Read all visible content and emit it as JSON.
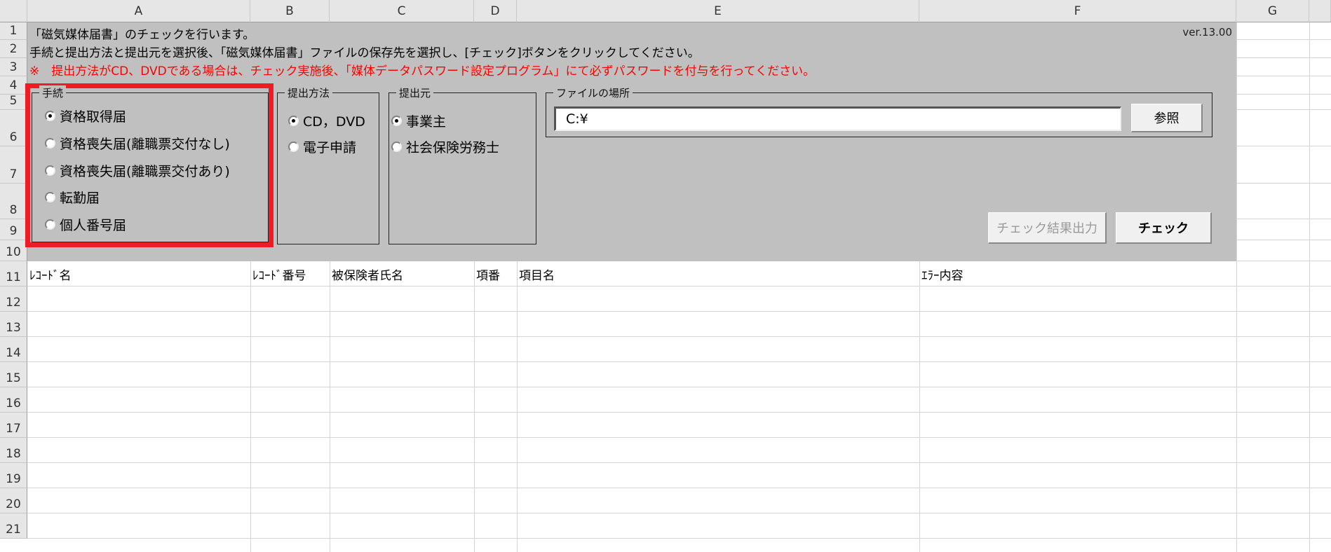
{
  "columns": [
    "A",
    "B",
    "C",
    "D",
    "E",
    "F",
    "G"
  ],
  "rows": [
    "1",
    "2",
    "3",
    "4",
    "5",
    "6",
    "7",
    "8",
    "9",
    "10",
    "11",
    "12",
    "13",
    "14",
    "15",
    "16",
    "17",
    "18",
    "19",
    "20",
    "21"
  ],
  "lines": {
    "line1": "「磁気媒体届書」のチェックを行います。",
    "line2": "手続と提出方法と提出元を選択後、「磁気媒体届書」ファイルの保存先を選択し、[チェック]ボタンをクリックしてください。",
    "line3": "※　提出方法がCD、DVDである場合は、チェック実施後、「媒体データパスワード設定プログラム」にて必ずパスワードを付与を行ってください。",
    "version": "ver.13.00"
  },
  "colors": {
    "warning": "#ff0000",
    "panel": "#c0c0c0",
    "highlight": "#ee1c25"
  },
  "procedure": {
    "label": "手続",
    "options": [
      "資格取得届",
      "資格喪失届(離職票交付なし)",
      "資格喪失届(離職票交付あり)",
      "転勤届",
      "個人番号届"
    ],
    "selected": 0
  },
  "method": {
    "label": "提出方法",
    "options": [
      "CD，DVD",
      "電子申請"
    ],
    "selected": 0
  },
  "submitter": {
    "label": "提出元",
    "options": [
      "事業主",
      "社会保険労務士"
    ],
    "selected": 0
  },
  "file": {
    "label": "ファイルの場所",
    "value": "C:¥",
    "browse": "参照"
  },
  "buttons": {
    "output": "チェック結果出力",
    "check": "チェック"
  },
  "table_headers": [
    "ﾚｺｰﾄﾞ名",
    "ﾚｺｰﾄﾞ番号",
    "被保険者氏名",
    "項番",
    "項目名",
    "ｴﾗｰ内容"
  ]
}
